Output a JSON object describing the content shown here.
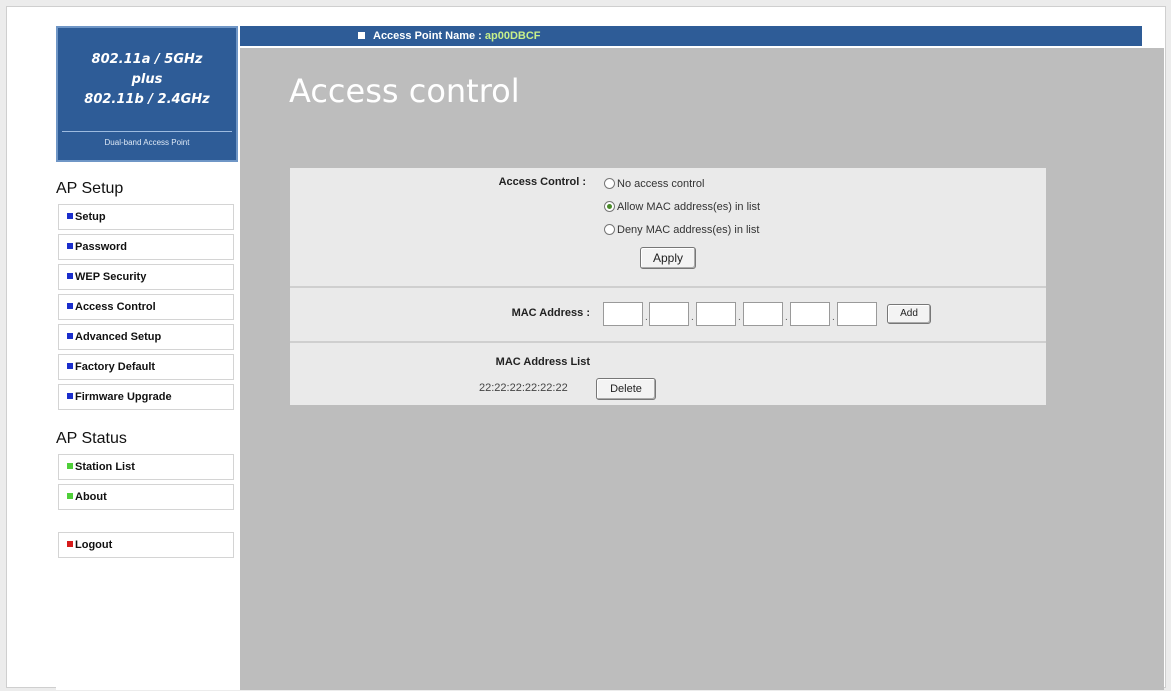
{
  "logo": {
    "line1": "802.11a / 5GHz",
    "line2": "plus",
    "line3": "802.11b / 2.4GHz",
    "subtitle": "Dual-band Access Point"
  },
  "sidebar": {
    "setup_title": "AP Setup",
    "setup_items": [
      {
        "label": "Setup",
        "color": "#1a2ecc"
      },
      {
        "label": "Password",
        "color": "#1a2ecc"
      },
      {
        "label": "WEP Security",
        "color": "#1a2ecc"
      },
      {
        "label": "Access Control",
        "color": "#1a2ecc"
      },
      {
        "label": "Advanced Setup",
        "color": "#1a2ecc"
      },
      {
        "label": "Factory Default",
        "color": "#1a2ecc"
      },
      {
        "label": "Firmware Upgrade",
        "color": "#1a2ecc"
      }
    ],
    "status_title": "AP Status",
    "status_items": [
      {
        "label": "Station List",
        "color": "#4fcf3a"
      },
      {
        "label": "About",
        "color": "#4fcf3a"
      }
    ],
    "logout": {
      "label": "Logout",
      "color": "#d61b1b"
    }
  },
  "header": {
    "ap_name_label": "Access Point Name :",
    "ap_name_value": "ap00DBCF"
  },
  "page_title": "Access control",
  "access_control": {
    "label": "Access Control :",
    "options": [
      {
        "label": "No access control",
        "selected": false
      },
      {
        "label": "Allow MAC address(es) in list",
        "selected": true
      },
      {
        "label": "Deny MAC address(es) in list",
        "selected": false
      }
    ],
    "apply_label": "Apply"
  },
  "mac_address": {
    "label": "MAC Address :",
    "fields": [
      "",
      "",
      "",
      "",
      "",
      ""
    ],
    "add_label": "Add"
  },
  "mac_list": {
    "title": "MAC Address List",
    "entries": [
      {
        "mac": "22:22:22:22:22:22",
        "delete_label": "Delete"
      }
    ]
  }
}
